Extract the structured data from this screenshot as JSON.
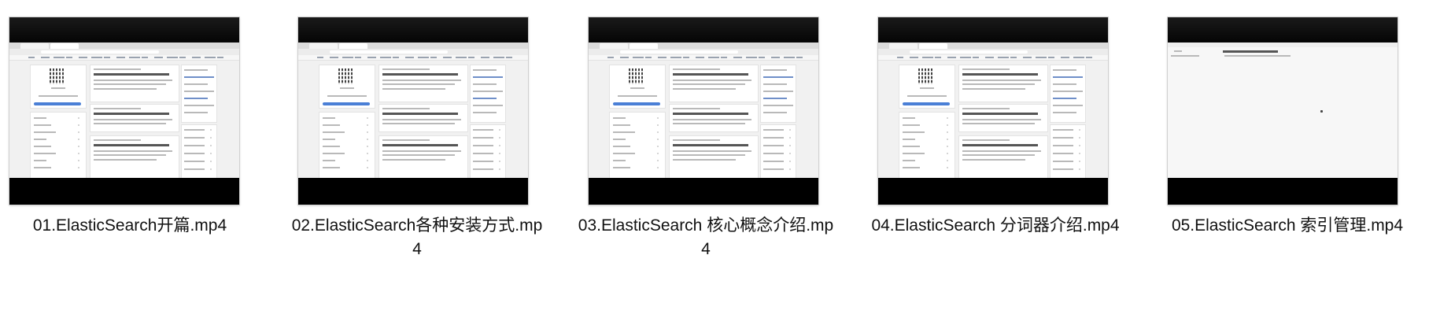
{
  "files": [
    {
      "name": "01.ElasticSearch开篇.mp4",
      "thumb_variant": "blog"
    },
    {
      "name": "02.ElasticSearch各种安装方式.mp4",
      "thumb_variant": "blog"
    },
    {
      "name": "03.ElasticSearch 核心概念介绍.mp4",
      "thumb_variant": "blog"
    },
    {
      "name": "04.ElasticSearch 分词器介绍.mp4",
      "thumb_variant": "blog"
    },
    {
      "name": "05.ElasticSearch 索引管理.mp4",
      "thumb_variant": "doc"
    }
  ],
  "colors": {
    "background": "#ffffff",
    "caption_text": "#111111",
    "thumb_letterbox": "#000000",
    "accent_blue": "#4a7fd6"
  }
}
